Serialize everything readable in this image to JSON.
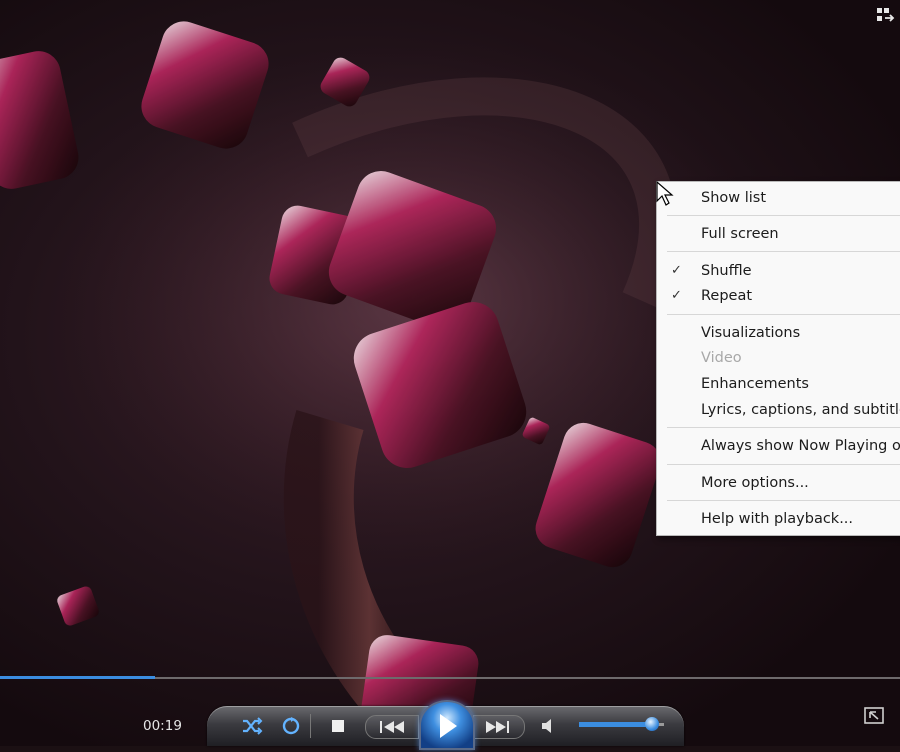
{
  "player": {
    "current_time": "00:19",
    "seek_progress": 0.172,
    "volume_level": 0.86
  },
  "context_menu": {
    "items": [
      {
        "label": "Show list",
        "checked": false,
        "enabled": true
      },
      {
        "label": "Full screen",
        "checked": false,
        "enabled": true
      },
      {
        "label": "Shuffle",
        "checked": true,
        "enabled": true
      },
      {
        "label": "Repeat",
        "checked": true,
        "enabled": true
      },
      {
        "label": "Visualizations",
        "checked": false,
        "enabled": true
      },
      {
        "label": "Video",
        "checked": false,
        "enabled": false
      },
      {
        "label": "Enhancements",
        "checked": false,
        "enabled": true
      },
      {
        "label": "Lyrics, captions, and subtitles",
        "checked": false,
        "enabled": true
      },
      {
        "label": "Always show Now Playing on t",
        "checked": false,
        "enabled": true
      },
      {
        "label": "More options...",
        "checked": false,
        "enabled": true
      },
      {
        "label": "Help with playback...",
        "checked": false,
        "enabled": true
      }
    ],
    "check_glyph": "✓"
  },
  "colors": {
    "accent": "#3b8de0",
    "menu_bg": "#f9f9f9",
    "menu_text": "#1c1c1c",
    "disabled_text": "#a8a8a8"
  },
  "icons": {
    "top_right": "switch-to-library-icon",
    "shuffle": "shuffle-icon",
    "repeat": "repeat-icon",
    "stop": "stop-icon",
    "previous": "previous-icon",
    "play": "play-icon",
    "next": "next-icon",
    "mute": "speaker-icon",
    "bottom_right": "switch-to-compact-mode-icon"
  }
}
